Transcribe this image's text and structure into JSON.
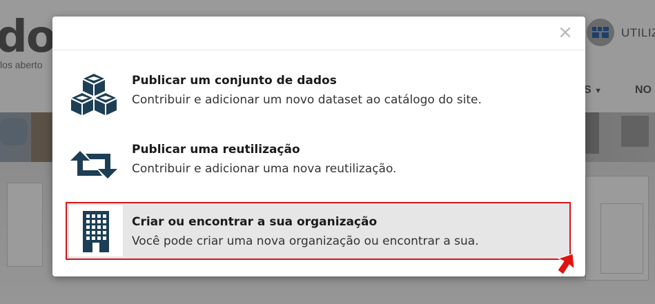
{
  "background": {
    "logo_text": "do",
    "tagline": "los aberto",
    "user_label": "UTILIZ",
    "nav": [
      "S",
      "NO"
    ]
  },
  "modal": {
    "close_symbol": "×",
    "options": [
      {
        "title": "Publicar um conjunto de dados",
        "description": "Contribuir e adicionar um novo dataset ao catálogo do site.",
        "icon": "cubes-icon"
      },
      {
        "title": "Publicar uma reutilização",
        "description": "Contribuir e adicionar uma nova reutilização.",
        "icon": "retweet-icon"
      },
      {
        "title": "Criar ou encontrar a sua organização",
        "description": "Você pode criar uma nova organização ou encontrar a sua.",
        "icon": "building-icon",
        "highlighted": true
      }
    ]
  },
  "colors": {
    "icon_color": "#1d3f55",
    "highlight_border": "#d3161b",
    "highlight_bg": "#e6e6e6",
    "overlay": "#8f8f8f"
  }
}
